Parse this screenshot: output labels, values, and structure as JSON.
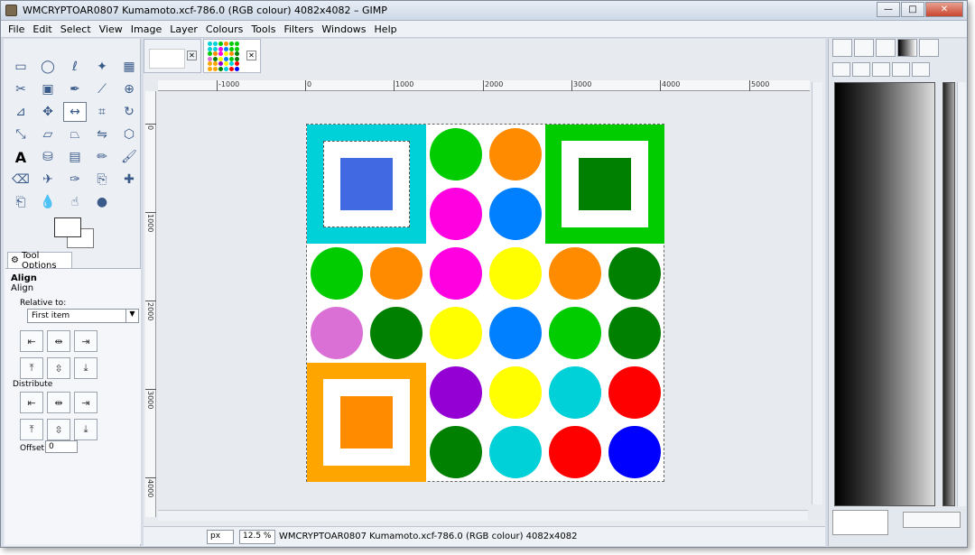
{
  "window": {
    "title": "WMCRYPTOAR0807 Kumamoto.xcf-786.0 (RGB colour) 4082x4082 – GIMP",
    "minimize": "—",
    "maximize": "□",
    "close": "✕"
  },
  "menu": [
    "File",
    "Edit",
    "Select",
    "View",
    "Image",
    "Layer",
    "Colours",
    "Tools",
    "Filters",
    "Windows",
    "Help"
  ],
  "toolbox": {
    "tool_options_tab": "Tool Options",
    "align_title": "Align",
    "align_sub": "Align",
    "relative_to_label": "Relative to:",
    "relative_to_value": "First item",
    "distribute_label": "Distribute",
    "offset_label": "Offset:",
    "offset_value": "0"
  },
  "ruler": {
    "h_labels": [
      "-1000",
      "0",
      "1000",
      "2000",
      "3000",
      "4000",
      "5000"
    ],
    "v_labels": [
      "0",
      "1000",
      "2000",
      "3000",
      "4000"
    ]
  },
  "status": {
    "unit": "px",
    "zoom": "12.5 %",
    "text": "WMCRYPTOAR0807 Kumamoto.xcf-786.0 (RGB colour) 4082x4082"
  },
  "colors": {
    "cyan_square": "#00d0d8",
    "blue_inner": "#4169e1",
    "green_square": "#00cc00",
    "green_inner": "#008000",
    "orange_square": "#ffa500",
    "orange_inner": "#ff8c00"
  },
  "circles": [
    [
      "#00cc00",
      "#ff8c00"
    ],
    [
      "#ff00e0",
      "#0080ff"
    ],
    [
      "#00cc00",
      "#ff8c00",
      "#ff00e0",
      "#ffff00",
      "#ff8c00",
      "#008000"
    ],
    [
      "#da70d6",
      "#008000",
      "#ffff00",
      "#0080ff",
      "#00cc00",
      "#008000"
    ],
    [
      "#9400d3",
      "#ffff00",
      "#00d0d8",
      "#ff0000"
    ],
    [
      "#008000",
      "#00d0d8",
      "#ff0000",
      "#0000ff"
    ]
  ]
}
